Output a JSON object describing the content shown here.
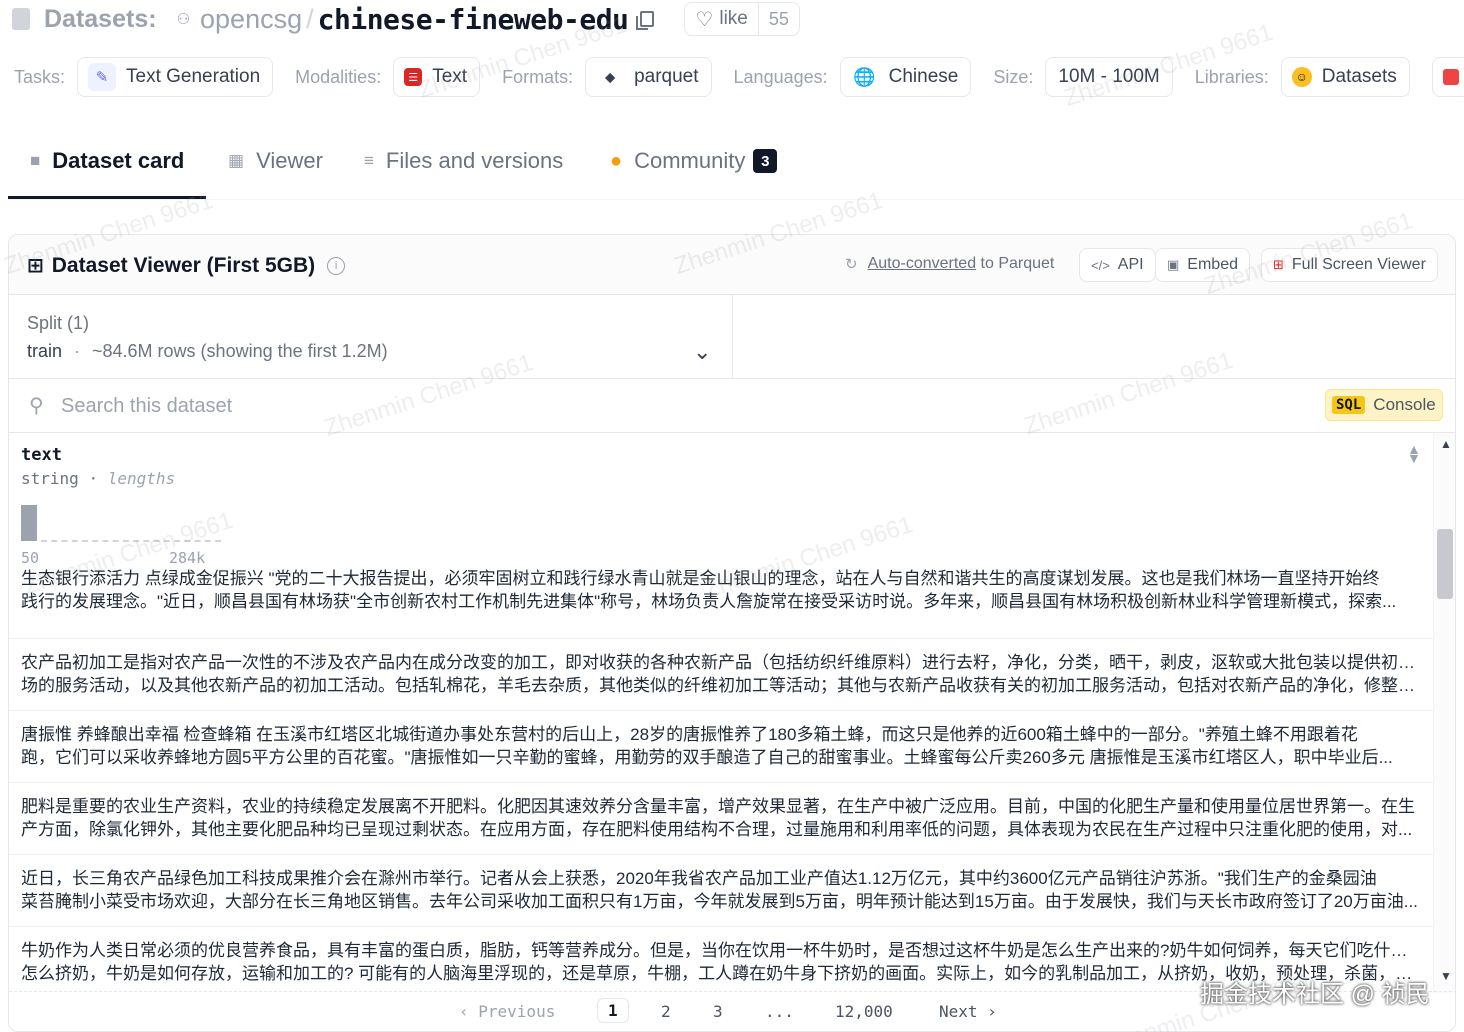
{
  "header": {
    "prefix": "Datasets:",
    "owner": "opencsg",
    "name": "chinese-fineweb-edu",
    "like_label": "like",
    "like_count": "55"
  },
  "tags": {
    "tasks_label": "Tasks:",
    "task": "Text Generation",
    "modalities_label": "Modalities:",
    "modality": "Text",
    "formats_label": "Formats:",
    "format": "parquet",
    "languages_label": "Languages:",
    "language": "Chinese",
    "size_label": "Size:",
    "size": "10M - 100M",
    "libraries_label": "Libraries:",
    "library": "Datasets"
  },
  "tabs": {
    "card": "Dataset card",
    "viewer": "Viewer",
    "files": "Files and versions",
    "community": "Community",
    "community_count": "3"
  },
  "viewer": {
    "title": "Dataset Viewer (First 5GB)",
    "auto_converted_link": "Auto-converted",
    "auto_converted_rest": " to Parquet",
    "api_label": "API",
    "embed_label": "Embed",
    "fullscreen_label": "Full Screen Viewer",
    "split_label": "Split (1)",
    "split_name": "train",
    "split_dot": "·",
    "split_rows": "~84.6M rows (showing the first 1.2M)",
    "search_placeholder": "Search this dataset",
    "sql_badge": "SQL",
    "sql_label": "Console"
  },
  "column": {
    "name": "text",
    "type": "string",
    "sep": "·",
    "stat": "lengths",
    "min": "50",
    "max": "284k"
  },
  "rows": [
    {
      "line1": "生态银行添活力 点绿成金促振兴 \"党的二十大报告提出，必须牢固树立和践行绿水青山就是金山银山的理念，站在人与自然和谐共生的高度谋划发展。这也是我们林场一直坚持开始终",
      "line2": "践行的发展理念。\"近日，顺昌县国有林场获\"全市创新农村工作机制先进集体\"称号，林场负责人詹旋常在接受采访时说。多年来，顺昌县国有林场积极创新林业科学管理新模式，探索..."
    },
    {
      "line1": "农产品初加工是指对农产品一次性的不涉及农产品内在成分改变的加工，即对收获的各种农新产品（包括纺织纤维原料）进行去籽，净化，分类，晒干，剥皮，沤软或大批包装以提供初级市",
      "line2": "场的服务活动，以及其他农新产品的初加工活动。包括轧棉花，羊毛去杂质，其他类似的纤维初加工等活动；其他与农新产品收获有关的初加工服务活动，包括对农新产品的净化，修整，..."
    },
    {
      "line1": "唐振惟 养蜂酿出幸福 检查蜂箱 在玉溪市红塔区北城街道办事处东营村的后山上，28岁的唐振惟养了180多箱土蜂，而这只是他养的近600箱土蜂中的一部分。\"养殖土蜂不用跟着花",
      "line2": "跑，它们可以采收养蜂地方圆5平方公里的百花蜜。\"唐振惟如一只辛勤的蜜蜂，用勤劳的双手酿造了自己的甜蜜事业。土蜂蜜每公斤卖260多元 唐振惟是玉溪市红塔区人，职中毕业后..."
    },
    {
      "line1": "肥料是重要的农业生产资料，农业的持续稳定发展离不开肥料。化肥因其速效养分含量丰富，增产效果显著，在生产中被广泛应用。目前，中国的化肥生产量和使用量位居世界第一。在生",
      "line2": "产方面，除氯化钾外，其他主要化肥品种均已呈现过剩状态。在应用方面，存在肥料使用结构不合理，过量施用和利用率低的问题，具体表现为农民在生产过程中只注重化肥的使用，对..."
    },
    {
      "line1": "近日，长三角农产品绿色加工科技成果推介会在滁州市举行。记者从会上获悉，2020年我省农产品加工业产值达1.12万亿元，其中约3600亿元产品销往沪苏浙。\"我们生产的金桑园油",
      "line2": "菜苔腌制小菜受市场欢迎，大部分在长三角地区销售。去年公司采收加工面积只有1万亩，今年就发展到5万亩，明年预计能达到15万亩。由于发展快，我们与天长市政府签订了20万亩油..."
    },
    {
      "line1": "牛奶作为人类日常必须的优良营养食品，具有丰富的蛋白质，脂肪，钙等营养成分。但是，当你在饮用一杯牛奶时，是否想过这杯牛奶是怎么生产出来的?奶牛如何饲养，每天它们吃什么，",
      "line2": "怎么挤奶，牛奶是如何存放，运输和加工的? 可能有的人脑海里浮现的，还是草原，牛棚，工人蹲在奶牛身下挤奶的画面。实际上，如今的乳制品加工，从挤奶，收奶，预处理，杀菌，发酵，..."
    }
  ],
  "pager": {
    "prev": "‹ Previous",
    "p1": "1",
    "p2": "2",
    "p3": "3",
    "ellipsis": "...",
    "last": "12,000",
    "next": "Next ›"
  },
  "watermark": "Zhenmin Chen 9661",
  "credit": "掘金技术社区 @ 祯民",
  "colors": {
    "accent_dark": "#111827",
    "sql_yellow": "#f5c518",
    "border": "#e5e7eb",
    "muted": "#9ca3af"
  }
}
